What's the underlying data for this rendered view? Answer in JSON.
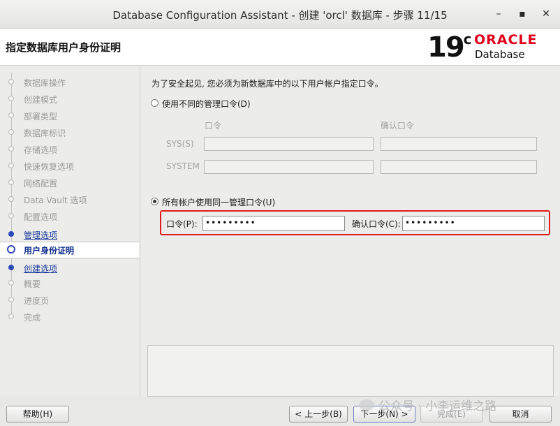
{
  "window": {
    "title": "Database Configuration Assistant - 创建 'orcl' 数据库 - 步骤 11/15",
    "minimize_symbol": "–",
    "maximize_symbol": "▪",
    "close_symbol": "✕"
  },
  "header": {
    "page_title": "指定数据库用户身份证明",
    "logo_version": "19",
    "logo_version_sup": "c",
    "logo_brand": "ORACLE",
    "logo_product": "Database"
  },
  "sidebar": {
    "steps": [
      {
        "label": "数据库操作",
        "state": "done"
      },
      {
        "label": "创建模式",
        "state": "done"
      },
      {
        "label": "部署类型",
        "state": "done"
      },
      {
        "label": "数据库标识",
        "state": "done"
      },
      {
        "label": "存储选项",
        "state": "done"
      },
      {
        "label": "快速恢复选项",
        "state": "done"
      },
      {
        "label": "网络配置",
        "state": "done"
      },
      {
        "label": "Data Vault 选项",
        "state": "done"
      },
      {
        "label": "配置选项",
        "state": "done"
      },
      {
        "label": "管理选项",
        "state": "link"
      },
      {
        "label": "用户身份证明",
        "state": "active"
      },
      {
        "label": "创建选项",
        "state": "link"
      },
      {
        "label": "概要",
        "state": "pending"
      },
      {
        "label": "进度页",
        "state": "pending"
      },
      {
        "label": "完成",
        "state": "pending"
      }
    ]
  },
  "main": {
    "intro": "为了安全起见, 您必须为新数据库中的以下用户帐户指定口令。",
    "option_different": "使用不同的管理口令(D)",
    "col_password": "口令",
    "col_confirm": "确认口令",
    "row_sys": "SYS(S)",
    "row_system": "SYSTEM",
    "option_same": "所有帐户使用同一管理口令(U)",
    "password_label": "口令(P):",
    "password_value": "•••••••••",
    "confirm_label": "确认口令(C):",
    "confirm_value": "•••••••••"
  },
  "buttons": {
    "help": "帮助(H)",
    "back": "< 上一步(B)",
    "next": "下一步(N) >",
    "finish": "完成(E)",
    "cancel": "取消"
  },
  "watermark": "公众号 · 小李运维之路",
  "colors": {
    "highlight_border": "#e01b1b",
    "oracle_red": "#e0001b",
    "active_step": "#0e2d8a",
    "link_step": "#1a3a9c"
  }
}
